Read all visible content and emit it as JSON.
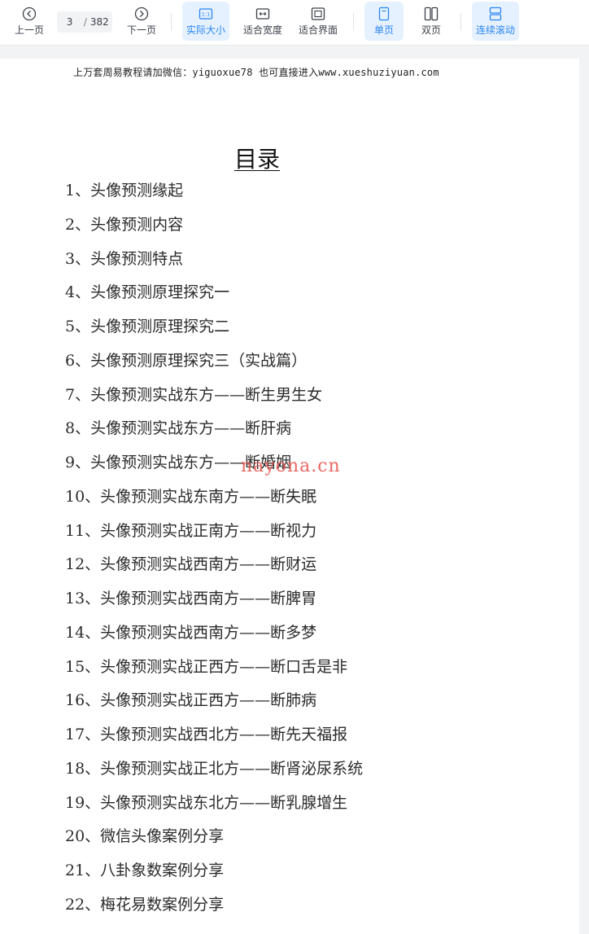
{
  "toolbar": {
    "prev_label": "上一页",
    "next_label": "下一页",
    "current_page": "3",
    "page_separator": "/",
    "total_pages": "382",
    "actual_size_label": "实际大小",
    "fit_width_label": "适合宽度",
    "fit_page_label": "适合界面",
    "single_page_label": "单页",
    "double_page_label": "双页",
    "continuous_scroll_label": "连续滚动",
    "actual_size_badge": "1:1",
    "accent_color": "#2a86f0"
  },
  "document": {
    "header_text": "上万套周易教程请加微信：yiguoxue78  也可直接进入www.xueshuziyuan.com",
    "toc_title": "目录",
    "watermark": "nayona.cn",
    "toc_items": [
      "1、头像预测缘起",
      "2、头像预测内容",
      "3、头像预测特点",
      "4、头像预测原理探究一",
      "5、头像预测原理探究二",
      "6、头像预测原理探究三（实战篇）",
      "7、头像预测实战东方——断生男生女",
      "8、头像预测实战东方——断肝病",
      "9、头像预测实战东方——断婚姻",
      "10、头像预测实战东南方——断失眠",
      "11、头像预测实战正南方——断视力",
      "12、头像预测实战西南方——断财运",
      "13、头像预测实战西南方——断脾胃",
      "14、头像预测实战西南方——断多梦",
      "15、头像预测实战正西方——断口舌是非",
      "16、头像预测实战正西方——断肺病",
      "17、头像预测实战西北方——断先天福报",
      "18、头像预测实战正北方——断肾泌尿系统",
      "19、头像预测实战东北方——断乳腺增生",
      "20、微信头像案例分享",
      "21、八卦象数案例分享",
      "22、梅花易数案例分享"
    ]
  }
}
